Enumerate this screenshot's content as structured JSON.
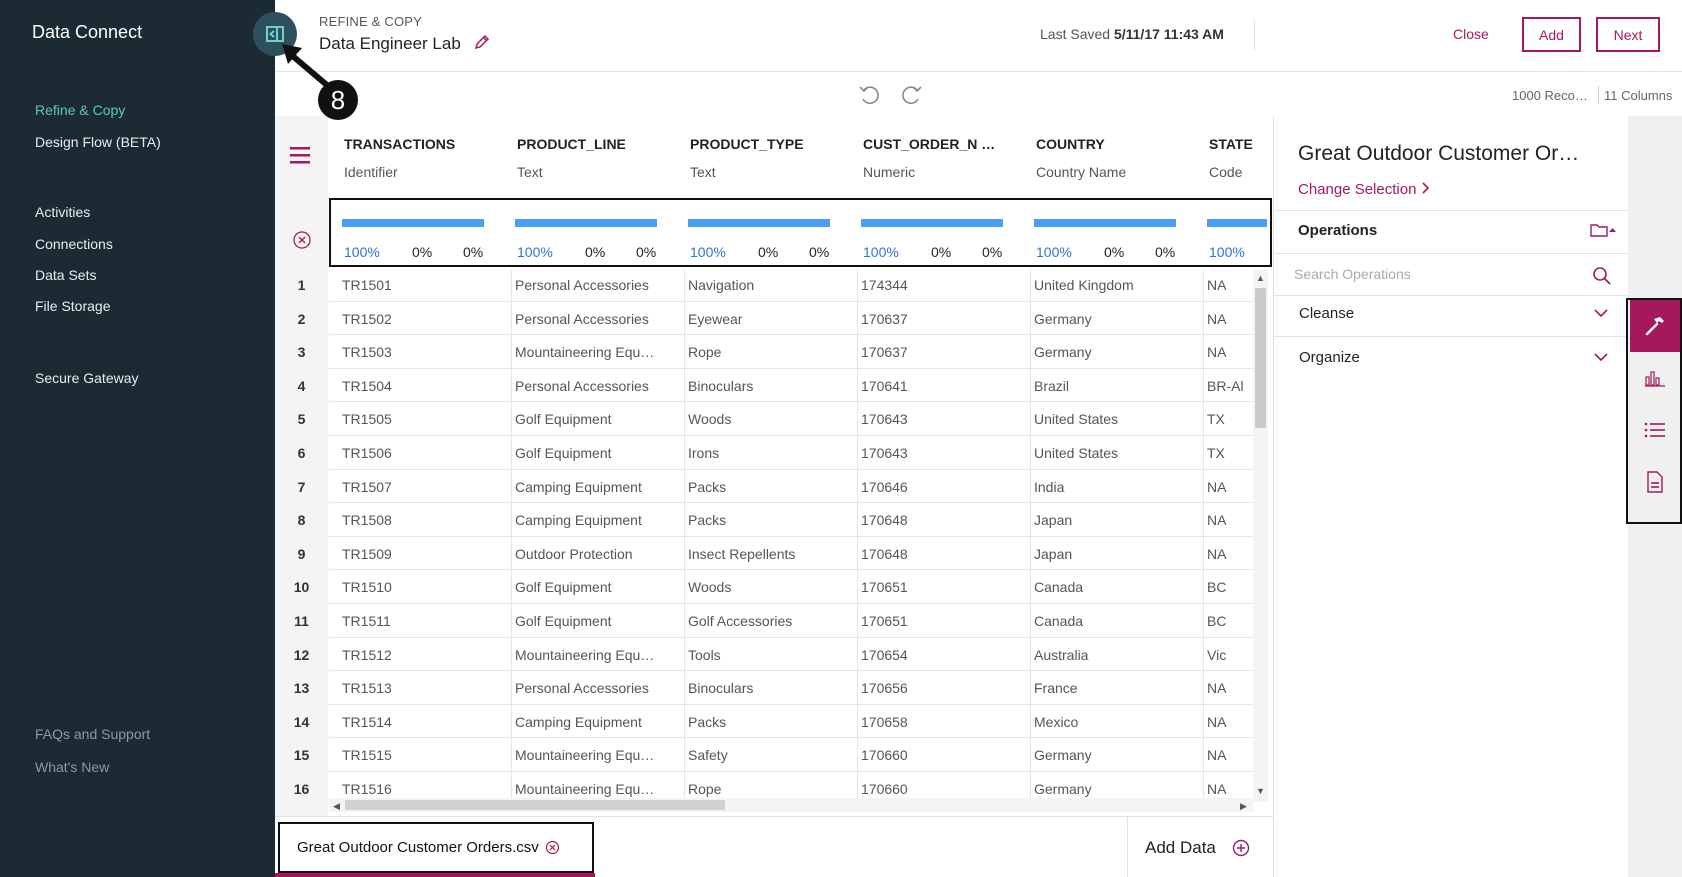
{
  "sidebar": {
    "brand": "Data Connect",
    "nav": [
      "Refine & Copy",
      "Design Flow (BETA)",
      "Activities",
      "Connections",
      "Data Sets",
      "File Storage",
      "Secure Gateway"
    ],
    "footer": [
      "FAQs and Support",
      "What's New"
    ]
  },
  "annotation": {
    "step": "8"
  },
  "header": {
    "crumb": "REFINE & COPY",
    "title": "Data Engineer Lab",
    "last_saved_label": "Last Saved",
    "last_saved_value": "5/11/17 11:43 AM",
    "close": "Close",
    "add": "Add",
    "next": "Next"
  },
  "toolbar": {
    "records": "1000 Reco…",
    "columns": "11 Columns"
  },
  "grid": {
    "columns": [
      {
        "name": "TRANSACTIONS",
        "type": "Identifier",
        "pct": [
          "100%",
          "0%",
          "0%"
        ]
      },
      {
        "name": "PRODUCT_LINE",
        "type": "Text",
        "pct": [
          "100%",
          "0%",
          "0%"
        ]
      },
      {
        "name": "PRODUCT_TYPE",
        "type": "Text",
        "pct": [
          "100%",
          "0%",
          "0%"
        ]
      },
      {
        "name": "CUST_ORDER_N …",
        "type": "Numeric",
        "pct": [
          "100%",
          "0%",
          "0%"
        ]
      },
      {
        "name": "COUNTRY",
        "type": "Country Name",
        "pct": [
          "100%",
          "0%",
          "0%"
        ]
      },
      {
        "name": "STATE",
        "type": "Code",
        "pct": [
          "100%"
        ]
      }
    ],
    "quality_fill": 1.0,
    "rows": [
      [
        "1",
        "TR1501",
        "Personal Accessories",
        "Navigation",
        "174344",
        "United Kingdom",
        "NA"
      ],
      [
        "2",
        "TR1502",
        "Personal Accessories",
        "Eyewear",
        "170637",
        "Germany",
        "NA"
      ],
      [
        "3",
        "TR1503",
        "Mountaineering Equ…",
        "Rope",
        "170637",
        "Germany",
        "NA"
      ],
      [
        "4",
        "TR1504",
        "Personal Accessories",
        "Binoculars",
        "170641",
        "Brazil",
        "BR-Al"
      ],
      [
        "5",
        "TR1505",
        "Golf Equipment",
        "Woods",
        "170643",
        "United States",
        "TX"
      ],
      [
        "6",
        "TR1506",
        "Golf Equipment",
        "Irons",
        "170643",
        "United States",
        "TX"
      ],
      [
        "7",
        "TR1507",
        "Camping Equipment",
        "Packs",
        "170646",
        "India",
        "NA"
      ],
      [
        "8",
        "TR1508",
        "Camping Equipment",
        "Packs",
        "170648",
        "Japan",
        "NA"
      ],
      [
        "9",
        "TR1509",
        "Outdoor Protection",
        "Insect Repellents",
        "170648",
        "Japan",
        "NA"
      ],
      [
        "10",
        "TR1510",
        "Golf Equipment",
        "Woods",
        "170651",
        "Canada",
        "BC"
      ],
      [
        "11",
        "TR1511",
        "Golf Equipment",
        "Golf Accessories",
        "170651",
        "Canada",
        "BC"
      ],
      [
        "12",
        "TR1512",
        "Mountaineering Equ…",
        "Tools",
        "170654",
        "Australia",
        "Vic"
      ],
      [
        "13",
        "TR1513",
        "Personal Accessories",
        "Binoculars",
        "170656",
        "France",
        "NA"
      ],
      [
        "14",
        "TR1514",
        "Camping Equipment",
        "Packs",
        "170658",
        "Mexico",
        "NA"
      ],
      [
        "15",
        "TR1515",
        "Mountaineering Equ…",
        "Safety",
        "170660",
        "Germany",
        "NA"
      ],
      [
        "16",
        "TR1516",
        "Mountaineering Equ…",
        "Rope",
        "170660",
        "Germany",
        "NA"
      ]
    ]
  },
  "bottom": {
    "file_tab": "Great Outdoor Customer Orders.csv",
    "add_data": "Add Data"
  },
  "panel": {
    "title": "Great Outdoor Customer Or…",
    "change_selection": "Change Selection",
    "operations": "Operations",
    "search_placeholder": "Search Operations",
    "sections": [
      "Cleanse",
      "Organize"
    ]
  },
  "tools": [
    "hammer-icon",
    "chart-icon",
    "list-icon",
    "document-icon"
  ],
  "colors": {
    "accent": "#a3195b",
    "sidebar": "#1c2b33",
    "active_nav": "#5fc8b4",
    "bar": "#4a9ff5",
    "pct": "#2d74da"
  }
}
